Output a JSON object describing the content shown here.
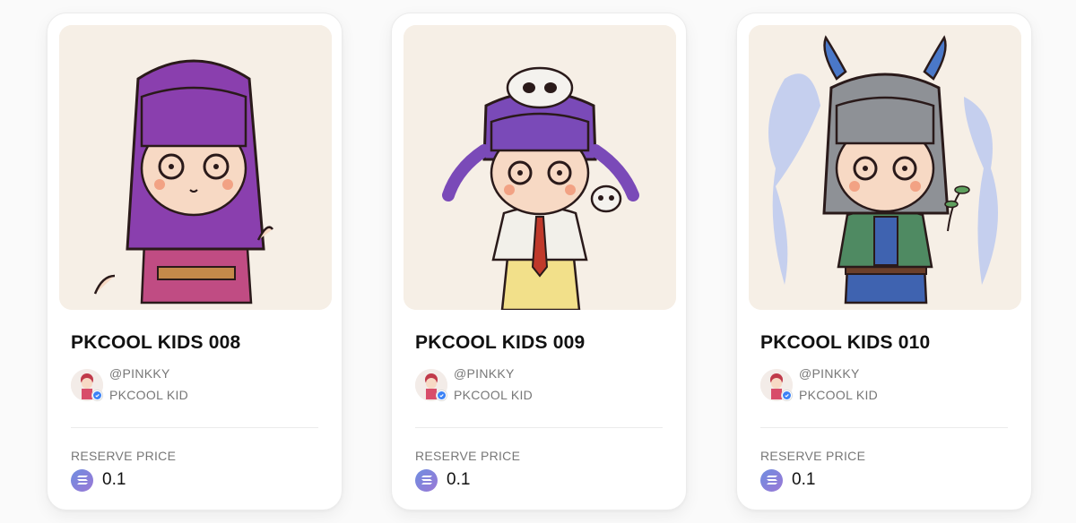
{
  "cards": [
    {
      "title": "PKCOOL KIDS 008",
      "creator_handle": "@PINKKY",
      "collection": "PKCOOL KID",
      "reserve_label": "RESERVE PRICE",
      "price": "0.1",
      "hair_color": "#8a3fae",
      "outfit_color": "#b8467a"
    },
    {
      "title": "PKCOOL KIDS 009",
      "creator_handle": "@PINKKY",
      "collection": "PKCOOL KID",
      "reserve_label": "RESERVE PRICE",
      "price": "0.1",
      "hair_color": "#7a4ab8",
      "outfit_color": "#f2f0ea"
    },
    {
      "title": "PKCOOL KIDS 010",
      "creator_handle": "@PINKKY",
      "collection": "PKCOOL KID",
      "reserve_label": "RESERVE PRICE",
      "price": "0.1",
      "hair_color": "#8e9196",
      "outfit_color": "#4f8a62"
    }
  ],
  "icons": {
    "price_currency": "solana-icon",
    "verified": "verified-check-icon"
  }
}
